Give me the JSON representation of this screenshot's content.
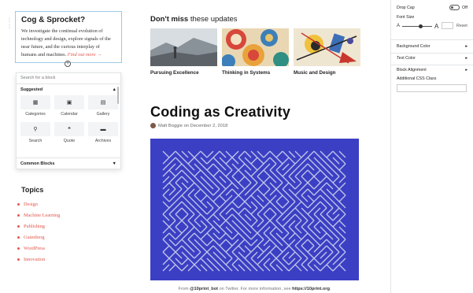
{
  "card": {
    "title": "Cog & Sprocket?",
    "body": "We investigate the continual evolution of technology and design, explore signals of the near future, and the curious interplay of humans and machines.",
    "read_more": "Find out more →"
  },
  "inserter": {
    "search_placeholder": "Search for a block",
    "suggested_label": "Suggested",
    "blocks": [
      {
        "label": "Categories",
        "icon": "grid-icon"
      },
      {
        "label": "Calendar",
        "icon": "calendar-icon"
      },
      {
        "label": "Gallery",
        "icon": "gallery-icon"
      },
      {
        "label": "Search",
        "icon": "search-icon"
      },
      {
        "label": "Quote",
        "icon": "quote-icon"
      },
      {
        "label": "Archives",
        "icon": "folder-icon"
      }
    ],
    "common_label": "Common Blocks"
  },
  "topics": {
    "heading": "Topics",
    "items": [
      "Design",
      "Machine Learning",
      "Publishing",
      "Gutenberg",
      "WordPress",
      "Innovation"
    ]
  },
  "dont_miss": {
    "strong": "Don't miss",
    "rest": "these updates"
  },
  "thumbnails": [
    {
      "caption": "Pursuing Excellence"
    },
    {
      "caption": "Thinking in Systems"
    },
    {
      "caption": "Music and Design"
    }
  ],
  "post": {
    "title": "Coding as Creativity",
    "author": "Matt Boggie",
    "date_prefix": "on",
    "date": "December 2, 2018",
    "caption_pre": "From",
    "caption_handle": "@10print_bot",
    "caption_mid": "on Twitter. For more information, see",
    "caption_link": "https://10print.org",
    "caption_end": "."
  },
  "sidebar": {
    "drop_cap_label": "Drop Cap",
    "drop_cap_state": "Off",
    "font_size_label": "Font Size",
    "font_small": "A",
    "font_large": "A",
    "reset_label": "Reset",
    "background_color_label": "Background Color",
    "text_color_label": "Text Color",
    "block_alignment_label": "Block Alignment",
    "additional_css_label": "Additional CSS Class"
  },
  "colors": {
    "accent": "#e2574c",
    "maze_background": "#3b3fc4",
    "maze_lines": "#bfc6e6"
  }
}
